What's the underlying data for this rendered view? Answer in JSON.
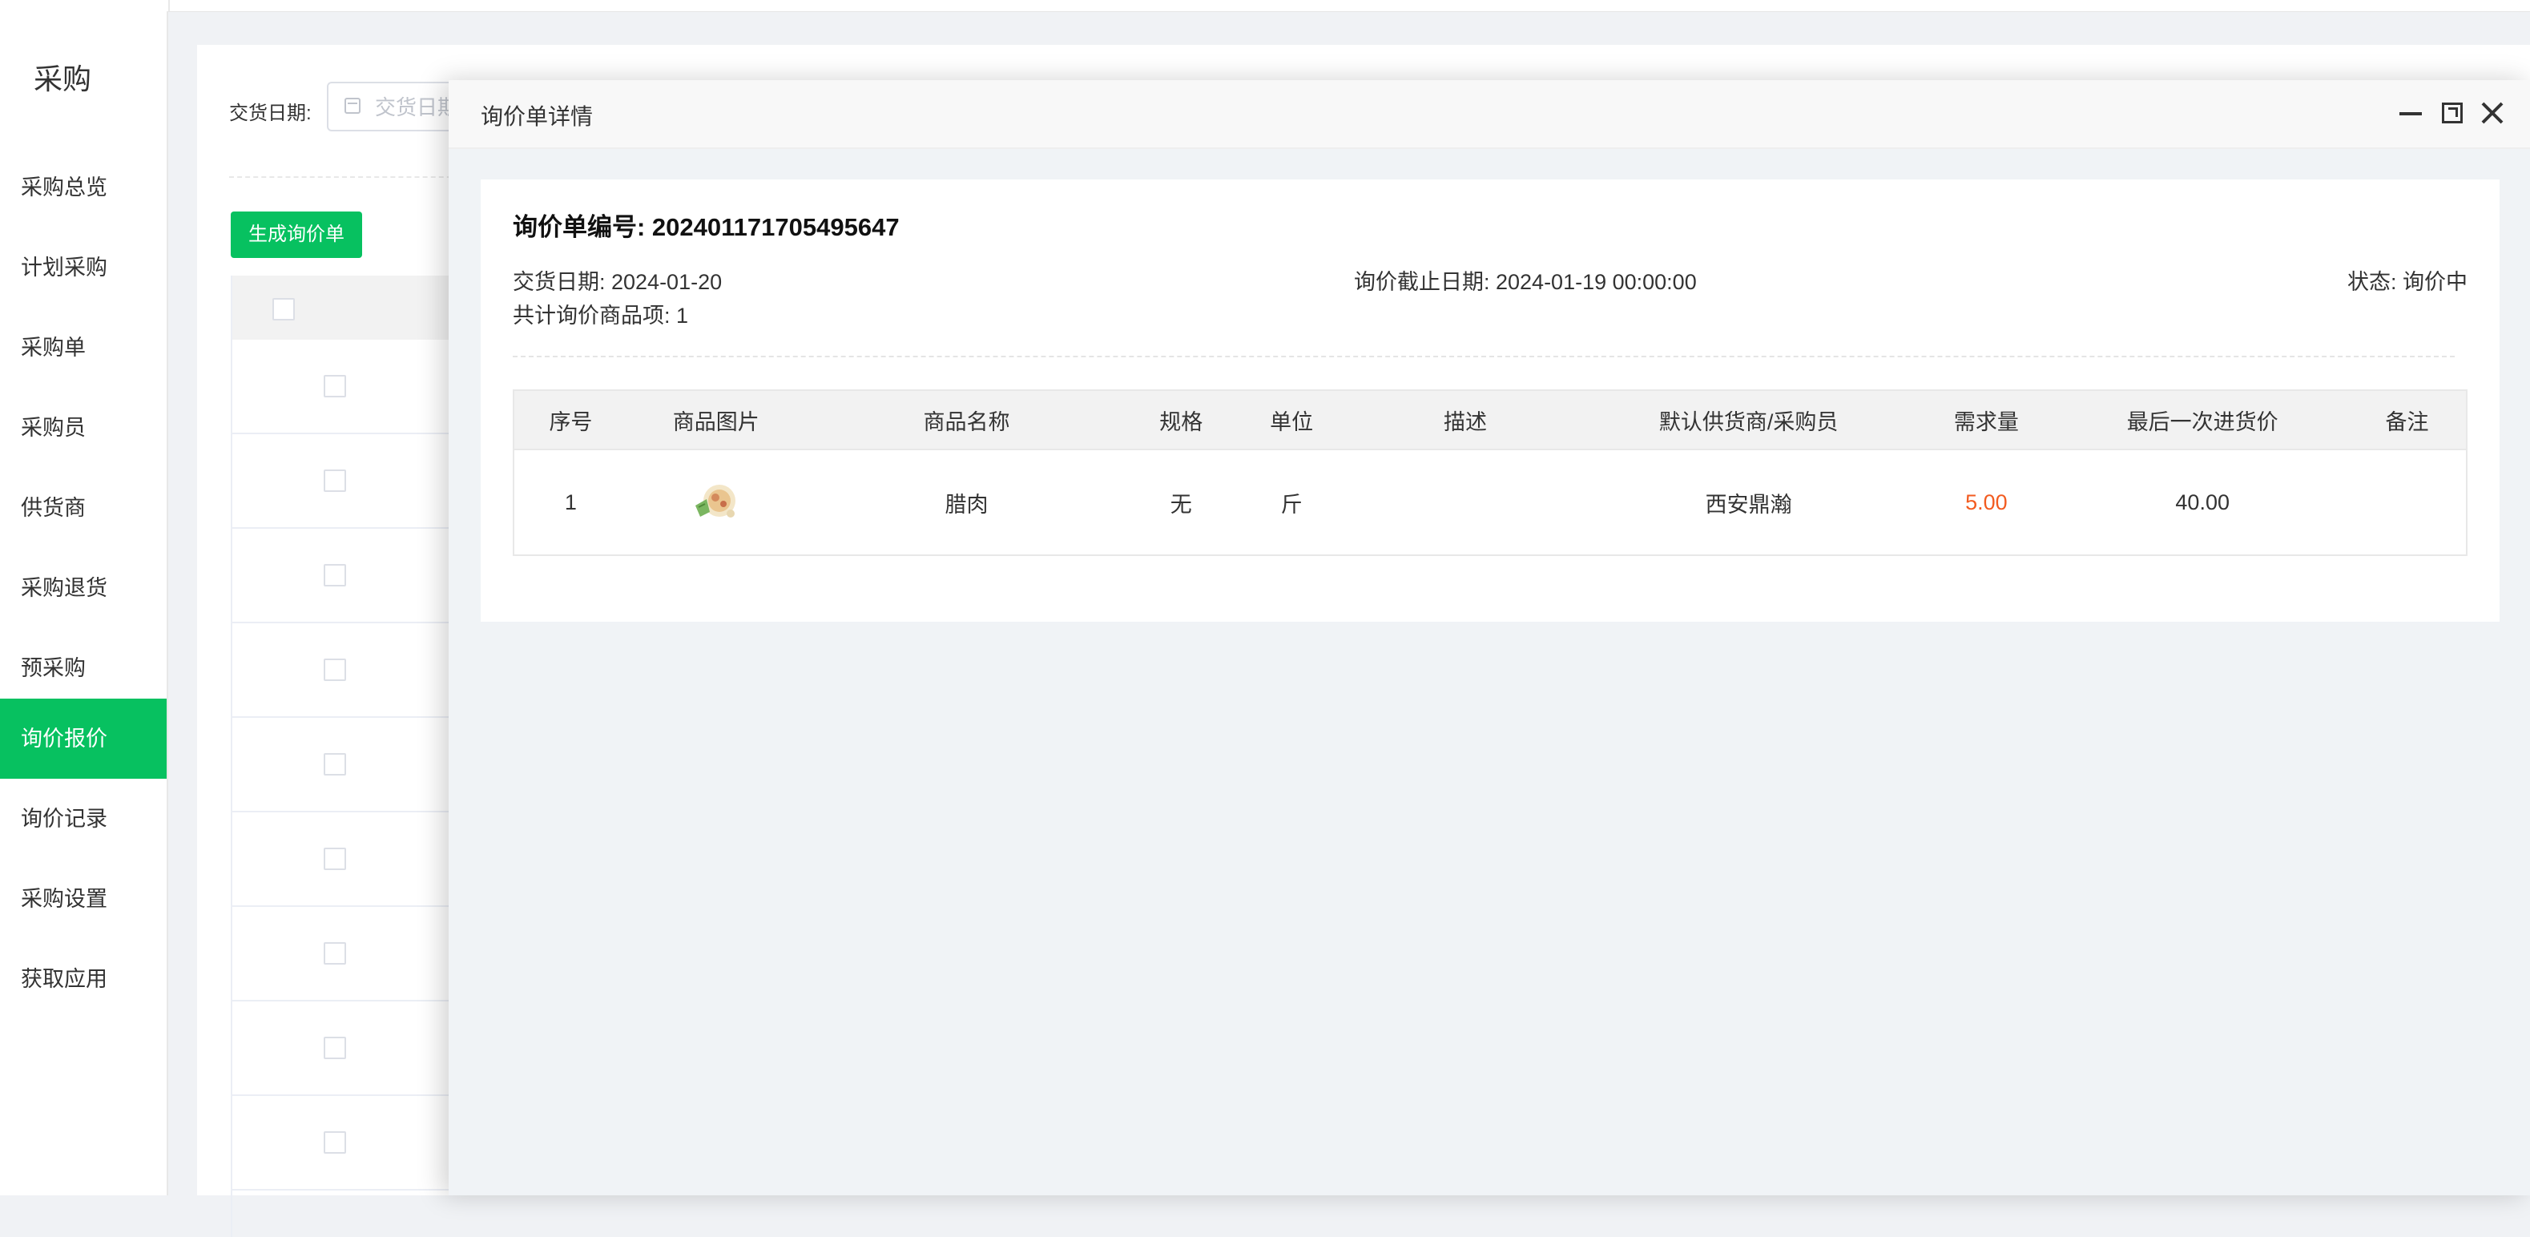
{
  "sidebar": {
    "title": "采购",
    "items": [
      {
        "label": "采购总览"
      },
      {
        "label": "计划采购"
      },
      {
        "label": "采购单"
      },
      {
        "label": "采购员"
      },
      {
        "label": "供货商"
      },
      {
        "label": "采购退货"
      },
      {
        "label": "预采购"
      },
      {
        "label": "询价报价",
        "active": true
      },
      {
        "label": "询价记录"
      },
      {
        "label": "采购设置"
      },
      {
        "label": "获取应用"
      }
    ]
  },
  "filter": {
    "date_label": "交货日期:",
    "date_placeholder": "交货日期"
  },
  "toolbar": {
    "generate_label": "生成询价单"
  },
  "modal": {
    "title": "询价单详情",
    "inquiry_no": "询价单编号: 202401171705495647",
    "delivery_date": "交货日期: 2024-01-20",
    "deadline": "询价截止日期: 2024-01-19 00:00:00",
    "status": "状态: 询价中",
    "item_count": "共计询价商品项: 1",
    "table": {
      "columns": [
        "序号",
        "商品图片",
        "商品名称",
        "规格",
        "单位",
        "描述",
        "默认供货商/采购员",
        "需求量",
        "最后一次进货价",
        "备注"
      ],
      "rows": [
        {
          "index": "1",
          "image": "product-thumbnail",
          "name": "腊肉",
          "spec": "无",
          "unit": "斤",
          "desc": "",
          "supplier": "西安鼎瀚",
          "qty": "5.00",
          "last_price": "40.00",
          "remark": ""
        }
      ]
    }
  },
  "colors": {
    "accent_green": "#07c160",
    "qty_orange": "#f25b20"
  }
}
